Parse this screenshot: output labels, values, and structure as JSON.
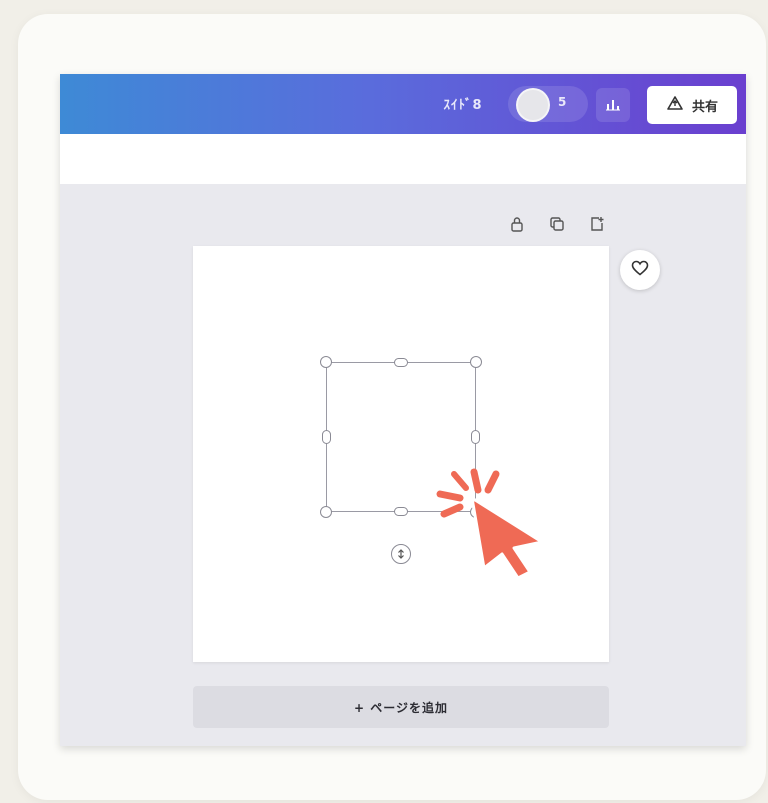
{
  "header": {
    "title": "ｽｲﾄﾞ8",
    "avatar_count": "5",
    "share_label": "共有"
  },
  "canvas": {
    "add_page_label": "+ ページを追加"
  },
  "colors": {
    "topbar_gradient_start": "#3e8ad6",
    "topbar_gradient_end": "#6a3fcf",
    "cursor_accent": "#ef6a55",
    "workspace_bg": "#e9e9ee"
  },
  "icons": {
    "stats": "bar-chart-icon",
    "share": "upload-icon",
    "lock": "lock-icon",
    "duplicate": "copy-icon",
    "new_page": "add-page-icon",
    "comment": "heart-icon",
    "rotate": "rotate-icon",
    "cursor": "click-cursor-icon"
  }
}
